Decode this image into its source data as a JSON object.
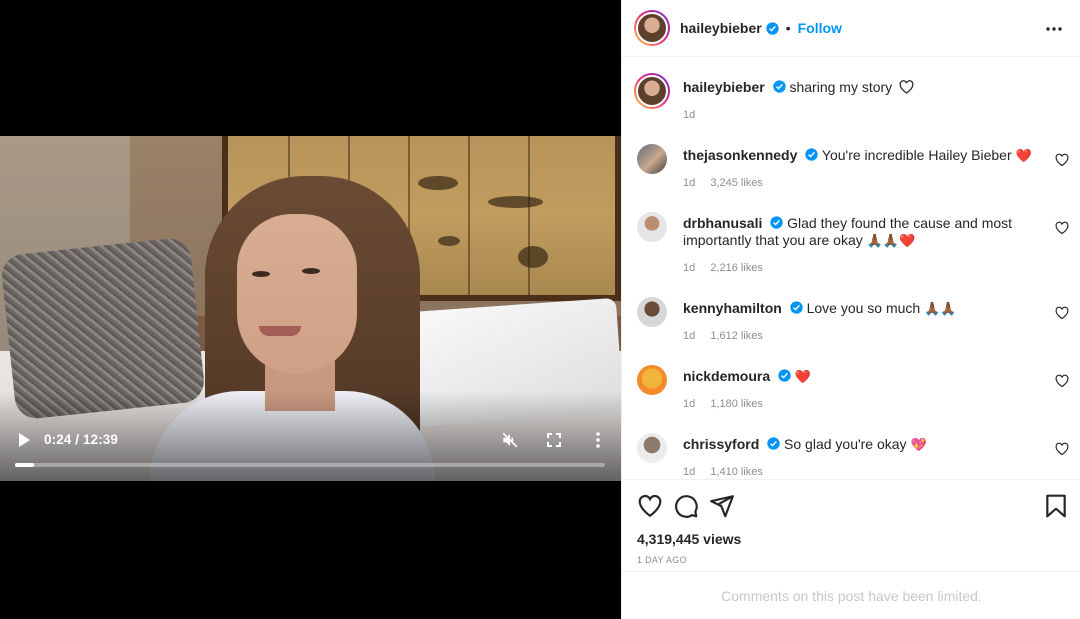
{
  "video": {
    "current_time": "0:24",
    "duration": "12:39",
    "time_text": "0:24 / 12:39",
    "progress_fraction": 0.032
  },
  "header": {
    "username": "haileybieber",
    "separator": "•",
    "follow_label": "Follow"
  },
  "caption": {
    "username": "haileybieber",
    "text": "sharing my story",
    "age": "1d"
  },
  "comments": [
    {
      "username": "thejasonkennedy",
      "verified": true,
      "text": "You're incredible Hailey Bieber",
      "emoji": "❤️",
      "age": "1d",
      "likes": "3,245 likes"
    },
    {
      "username": "drbhanusali",
      "verified": true,
      "text": "Glad they found the cause and most importantly that you are okay",
      "emoji": "🙏🏾🙏🏾❤️",
      "age": "1d",
      "likes": "2,216 likes"
    },
    {
      "username": "kennyhamilton",
      "verified": true,
      "text": "Love you so much",
      "emoji": "🙏🏾🙏🏾",
      "age": "1d",
      "likes": "1,612 likes"
    },
    {
      "username": "nickdemoura",
      "verified": true,
      "text": "",
      "emoji": "❤️",
      "age": "1d",
      "likes": "1,180 likes"
    },
    {
      "username": "chrissyford",
      "verified": true,
      "text": "So glad you're okay",
      "emoji": "💖",
      "age": "1d",
      "likes": "1,410 likes"
    }
  ],
  "stats": {
    "views": "4,319,445 views",
    "posted": "1 DAY AGO"
  },
  "footer": {
    "limited_text": "Comments on this post have been limited."
  },
  "colors": {
    "accent": "#0095f6",
    "heart": "#ed4956",
    "muted": "#8e8e8e"
  },
  "icons": [
    "play-icon",
    "mute-icon",
    "fullscreen-icon",
    "more-vertical-icon",
    "more-horizontal-icon",
    "verified-badge-icon",
    "heart-icon",
    "comment-icon",
    "share-icon",
    "bookmark-icon"
  ]
}
